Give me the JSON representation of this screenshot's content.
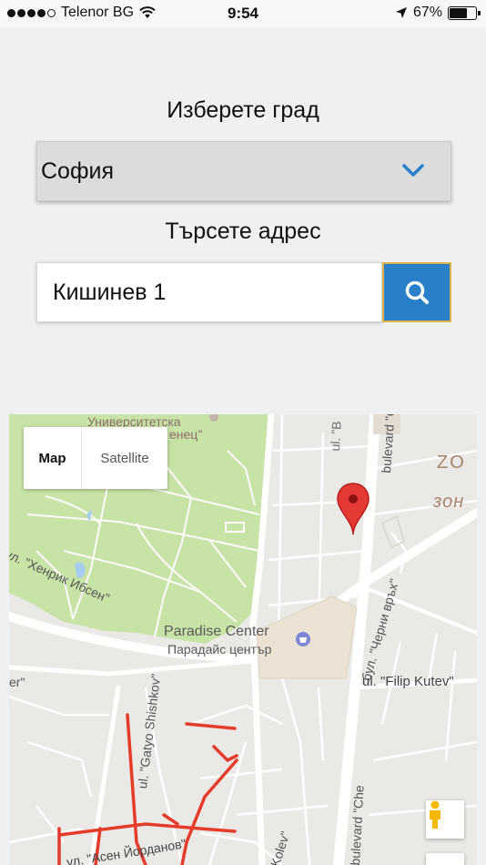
{
  "status_bar": {
    "carrier": "Telenor BG",
    "time": "9:54",
    "battery": "67%",
    "battery_level": 0.67
  },
  "form": {
    "city_label": "Изберете град",
    "city_value": "София",
    "address_label": "Търсете адрес",
    "address_value": "Кишинев 1"
  },
  "map": {
    "map_type": {
      "map_label": "Map",
      "satellite_label": "Satellite"
    },
    "labels": {
      "university_1": "Университетска",
      "university_2": "енец\"",
      "paradise_en": "Paradise Center",
      "paradise_bg": "Парадайс център",
      "henrik": "ул. \"Хенрик Ибсен\"",
      "cherni_vrah": "бул. \"Черни връх\"",
      "filip_kutev": "ul. \"Filip Kutev\"",
      "gatyo": "ul. \"Gatyo Shishkov\"",
      "asen": "ул. \"Асен Йорданов\"",
      "kolev": "Kolev\"",
      "boulevard_top": "bulevard \"Ch",
      "boulevard_bottom": "bulevard \"Che",
      "ul_top": "ul. \"В",
      "zone": "ZO",
      "zone_cyr": "зон",
      "left_frag": "er\""
    },
    "colors": {
      "park": "#c8e3a6",
      "road": "#ffffff",
      "mall": "#ebe2d3",
      "pin": "#e53935",
      "traffic": "#e53b2b"
    }
  }
}
